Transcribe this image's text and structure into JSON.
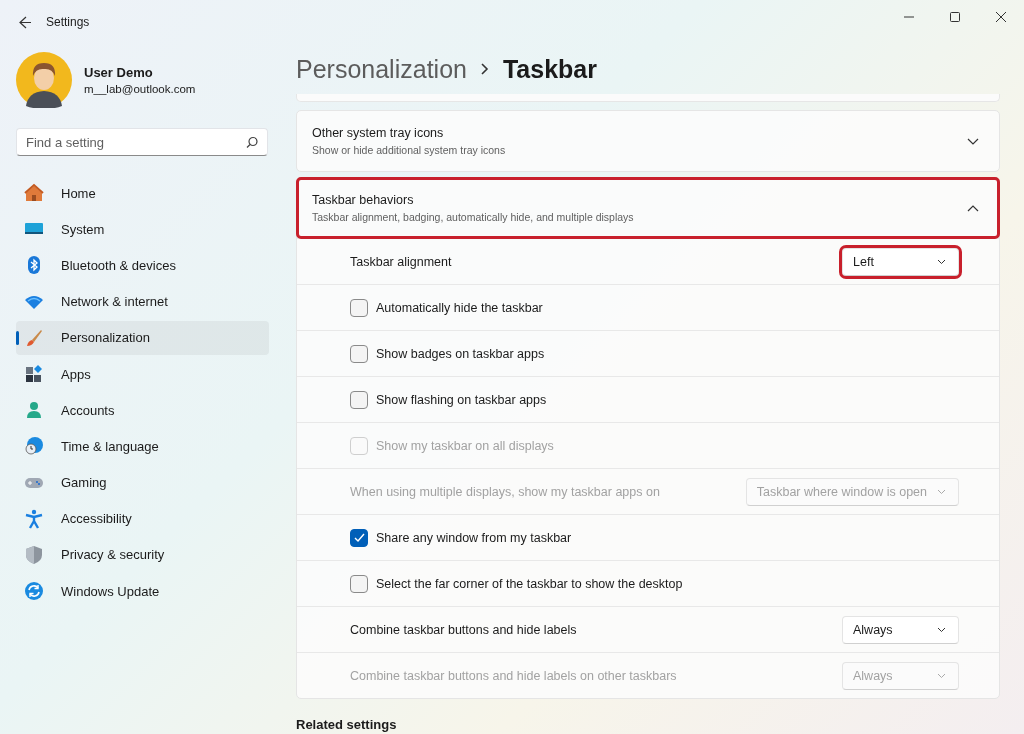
{
  "window": {
    "title": "Settings"
  },
  "user": {
    "name": "User Demo",
    "email": "m__lab@outlook.com"
  },
  "search": {
    "placeholder": "Find a setting"
  },
  "sidebar": {
    "items": [
      {
        "label": "Home",
        "selected": false
      },
      {
        "label": "System",
        "selected": false
      },
      {
        "label": "Bluetooth & devices",
        "selected": false
      },
      {
        "label": "Network & internet",
        "selected": false
      },
      {
        "label": "Personalization",
        "selected": true
      },
      {
        "label": "Apps",
        "selected": false
      },
      {
        "label": "Accounts",
        "selected": false
      },
      {
        "label": "Time & language",
        "selected": false
      },
      {
        "label": "Gaming",
        "selected": false
      },
      {
        "label": "Accessibility",
        "selected": false
      },
      {
        "label": "Privacy & security",
        "selected": false
      },
      {
        "label": "Windows Update",
        "selected": false
      }
    ]
  },
  "breadcrumb": {
    "parent": "Personalization",
    "current": "Taskbar"
  },
  "sections": [
    {
      "title": "Other system tray icons",
      "subtitle": "Show or hide additional system tray icons",
      "expanded": false,
      "highlighted": false
    },
    {
      "title": "Taskbar behaviors",
      "subtitle": "Taskbar alignment, badging, automatically hide, and multiple displays",
      "expanded": true,
      "highlighted": true,
      "rows": [
        {
          "kind": "dropdown",
          "label": "Taskbar alignment",
          "value": "Left",
          "disabled": false,
          "highlighted": true
        },
        {
          "kind": "checkbox",
          "label": "Automatically hide the taskbar",
          "checked": false,
          "disabled": false
        },
        {
          "kind": "checkbox",
          "label": "Show badges on taskbar apps",
          "checked": false,
          "disabled": false
        },
        {
          "kind": "checkbox",
          "label": "Show flashing on taskbar apps",
          "checked": false,
          "disabled": false
        },
        {
          "kind": "checkbox",
          "label": "Show my taskbar on all displays",
          "checked": false,
          "disabled": true
        },
        {
          "kind": "dropdown",
          "label": "When using multiple displays, show my taskbar apps on",
          "value": "Taskbar where window is open",
          "disabled": true,
          "highlighted": false
        },
        {
          "kind": "checkbox",
          "label": "Share any window from my taskbar",
          "checked": true,
          "disabled": false
        },
        {
          "kind": "checkbox",
          "label": "Select the far corner of the taskbar to show the desktop",
          "checked": false,
          "disabled": false
        },
        {
          "kind": "dropdown",
          "label": "Combine taskbar buttons and hide labels",
          "value": "Always",
          "disabled": false,
          "highlighted": false
        },
        {
          "kind": "dropdown",
          "label": "Combine taskbar buttons and hide labels on other taskbars",
          "value": "Always",
          "disabled": true,
          "highlighted": false
        }
      ]
    }
  ],
  "related_settings": {
    "title": "Related settings"
  }
}
